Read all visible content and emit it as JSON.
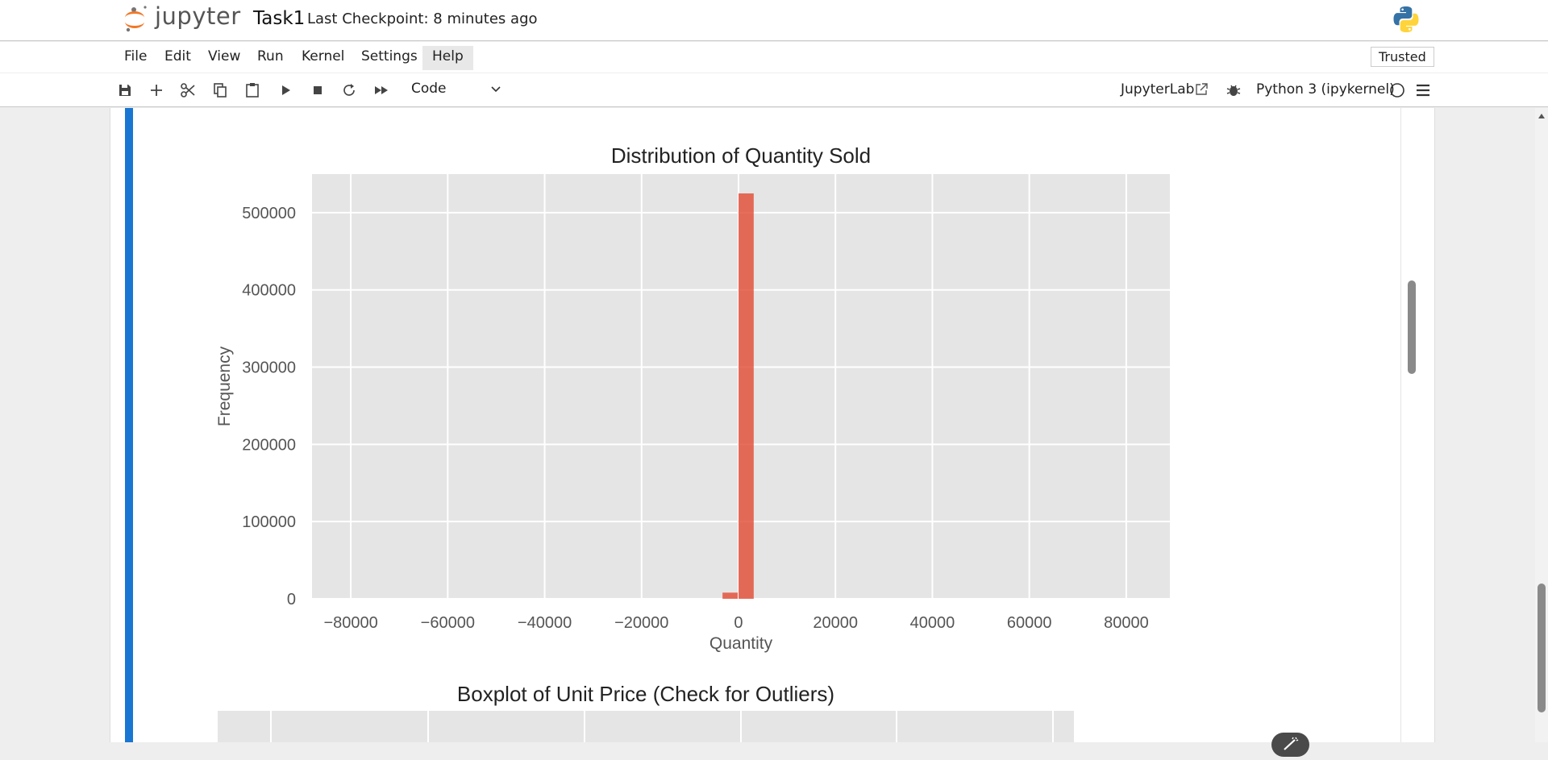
{
  "app": {
    "logo_text": "jupyter",
    "notebook_title": "Task1",
    "checkpoint": "Last Checkpoint: 8 minutes ago"
  },
  "menu": [
    "File",
    "Edit",
    "View",
    "Run",
    "Kernel",
    "Settings",
    "Help"
  ],
  "trusted_label": "Trusted",
  "toolbar": {
    "cell_type": "Code",
    "jupyterlab_label": "JupyterLab",
    "kernel_label": "Python 3 (ipykernel)"
  },
  "colors": {
    "accent": "#1976d2",
    "bar": "#e24a33",
    "plot_bg": "#e5e5e5"
  },
  "chart_data": [
    {
      "type": "bar",
      "title": "Distribution of Quantity Sold",
      "xlabel": "Quantity",
      "ylabel": "Frequency",
      "xlim": [
        -88000,
        89000
      ],
      "ylim": [
        0,
        550000
      ],
      "xticks": [
        "−80000",
        "−60000",
        "−40000",
        "−20000",
        "0",
        "20000",
        "40000",
        "60000",
        "80000"
      ],
      "xtick_values": [
        -80000,
        -60000,
        -40000,
        -20000,
        0,
        20000,
        40000,
        60000,
        80000
      ],
      "yticks": [
        "0",
        "100000",
        "200000",
        "300000",
        "400000",
        "500000"
      ],
      "ytick_values": [
        0,
        100000,
        200000,
        300000,
        400000,
        500000
      ],
      "bins": [
        {
          "x0": -3300,
          "x1": 0,
          "value": 8000
        },
        {
          "x0": 0,
          "x1": 3300,
          "value": 525000
        }
      ]
    },
    {
      "type": "box",
      "title": "Boxplot of Unit Price (Check for Outliers)"
    }
  ]
}
